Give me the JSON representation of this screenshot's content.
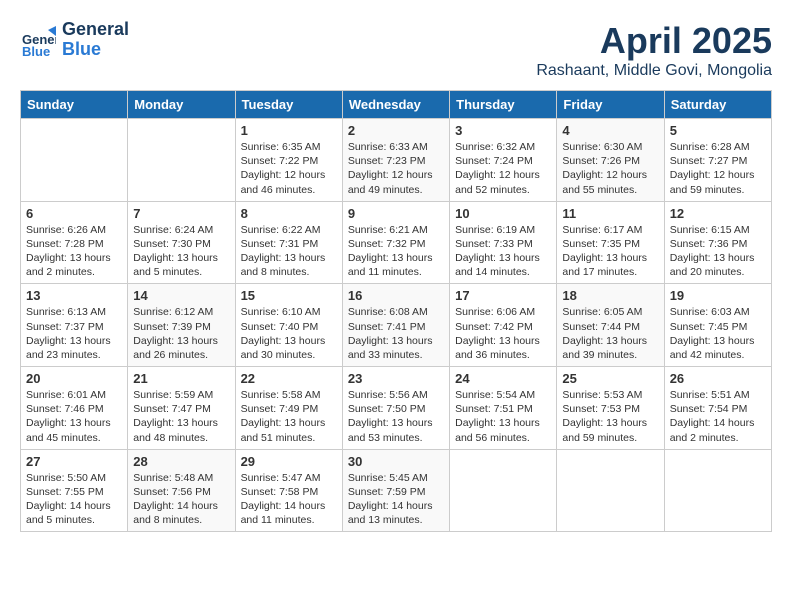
{
  "header": {
    "logo_line1": "General",
    "logo_line2": "Blue",
    "month": "April 2025",
    "location": "Rashaant, Middle Govi, Mongolia"
  },
  "weekdays": [
    "Sunday",
    "Monday",
    "Tuesday",
    "Wednesday",
    "Thursday",
    "Friday",
    "Saturday"
  ],
  "weeks": [
    [
      {
        "day": "",
        "info": ""
      },
      {
        "day": "",
        "info": ""
      },
      {
        "day": "1",
        "info": "Sunrise: 6:35 AM\nSunset: 7:22 PM\nDaylight: 12 hours and 46 minutes."
      },
      {
        "day": "2",
        "info": "Sunrise: 6:33 AM\nSunset: 7:23 PM\nDaylight: 12 hours and 49 minutes."
      },
      {
        "day": "3",
        "info": "Sunrise: 6:32 AM\nSunset: 7:24 PM\nDaylight: 12 hours and 52 minutes."
      },
      {
        "day": "4",
        "info": "Sunrise: 6:30 AM\nSunset: 7:26 PM\nDaylight: 12 hours and 55 minutes."
      },
      {
        "day": "5",
        "info": "Sunrise: 6:28 AM\nSunset: 7:27 PM\nDaylight: 12 hours and 59 minutes."
      }
    ],
    [
      {
        "day": "6",
        "info": "Sunrise: 6:26 AM\nSunset: 7:28 PM\nDaylight: 13 hours and 2 minutes."
      },
      {
        "day": "7",
        "info": "Sunrise: 6:24 AM\nSunset: 7:30 PM\nDaylight: 13 hours and 5 minutes."
      },
      {
        "day": "8",
        "info": "Sunrise: 6:22 AM\nSunset: 7:31 PM\nDaylight: 13 hours and 8 minutes."
      },
      {
        "day": "9",
        "info": "Sunrise: 6:21 AM\nSunset: 7:32 PM\nDaylight: 13 hours and 11 minutes."
      },
      {
        "day": "10",
        "info": "Sunrise: 6:19 AM\nSunset: 7:33 PM\nDaylight: 13 hours and 14 minutes."
      },
      {
        "day": "11",
        "info": "Sunrise: 6:17 AM\nSunset: 7:35 PM\nDaylight: 13 hours and 17 minutes."
      },
      {
        "day": "12",
        "info": "Sunrise: 6:15 AM\nSunset: 7:36 PM\nDaylight: 13 hours and 20 minutes."
      }
    ],
    [
      {
        "day": "13",
        "info": "Sunrise: 6:13 AM\nSunset: 7:37 PM\nDaylight: 13 hours and 23 minutes."
      },
      {
        "day": "14",
        "info": "Sunrise: 6:12 AM\nSunset: 7:39 PM\nDaylight: 13 hours and 26 minutes."
      },
      {
        "day": "15",
        "info": "Sunrise: 6:10 AM\nSunset: 7:40 PM\nDaylight: 13 hours and 30 minutes."
      },
      {
        "day": "16",
        "info": "Sunrise: 6:08 AM\nSunset: 7:41 PM\nDaylight: 13 hours and 33 minutes."
      },
      {
        "day": "17",
        "info": "Sunrise: 6:06 AM\nSunset: 7:42 PM\nDaylight: 13 hours and 36 minutes."
      },
      {
        "day": "18",
        "info": "Sunrise: 6:05 AM\nSunset: 7:44 PM\nDaylight: 13 hours and 39 minutes."
      },
      {
        "day": "19",
        "info": "Sunrise: 6:03 AM\nSunset: 7:45 PM\nDaylight: 13 hours and 42 minutes."
      }
    ],
    [
      {
        "day": "20",
        "info": "Sunrise: 6:01 AM\nSunset: 7:46 PM\nDaylight: 13 hours and 45 minutes."
      },
      {
        "day": "21",
        "info": "Sunrise: 5:59 AM\nSunset: 7:47 PM\nDaylight: 13 hours and 48 minutes."
      },
      {
        "day": "22",
        "info": "Sunrise: 5:58 AM\nSunset: 7:49 PM\nDaylight: 13 hours and 51 minutes."
      },
      {
        "day": "23",
        "info": "Sunrise: 5:56 AM\nSunset: 7:50 PM\nDaylight: 13 hours and 53 minutes."
      },
      {
        "day": "24",
        "info": "Sunrise: 5:54 AM\nSunset: 7:51 PM\nDaylight: 13 hours and 56 minutes."
      },
      {
        "day": "25",
        "info": "Sunrise: 5:53 AM\nSunset: 7:53 PM\nDaylight: 13 hours and 59 minutes."
      },
      {
        "day": "26",
        "info": "Sunrise: 5:51 AM\nSunset: 7:54 PM\nDaylight: 14 hours and 2 minutes."
      }
    ],
    [
      {
        "day": "27",
        "info": "Sunrise: 5:50 AM\nSunset: 7:55 PM\nDaylight: 14 hours and 5 minutes."
      },
      {
        "day": "28",
        "info": "Sunrise: 5:48 AM\nSunset: 7:56 PM\nDaylight: 14 hours and 8 minutes."
      },
      {
        "day": "29",
        "info": "Sunrise: 5:47 AM\nSunset: 7:58 PM\nDaylight: 14 hours and 11 minutes."
      },
      {
        "day": "30",
        "info": "Sunrise: 5:45 AM\nSunset: 7:59 PM\nDaylight: 14 hours and 13 minutes."
      },
      {
        "day": "",
        "info": ""
      },
      {
        "day": "",
        "info": ""
      },
      {
        "day": "",
        "info": ""
      }
    ]
  ]
}
